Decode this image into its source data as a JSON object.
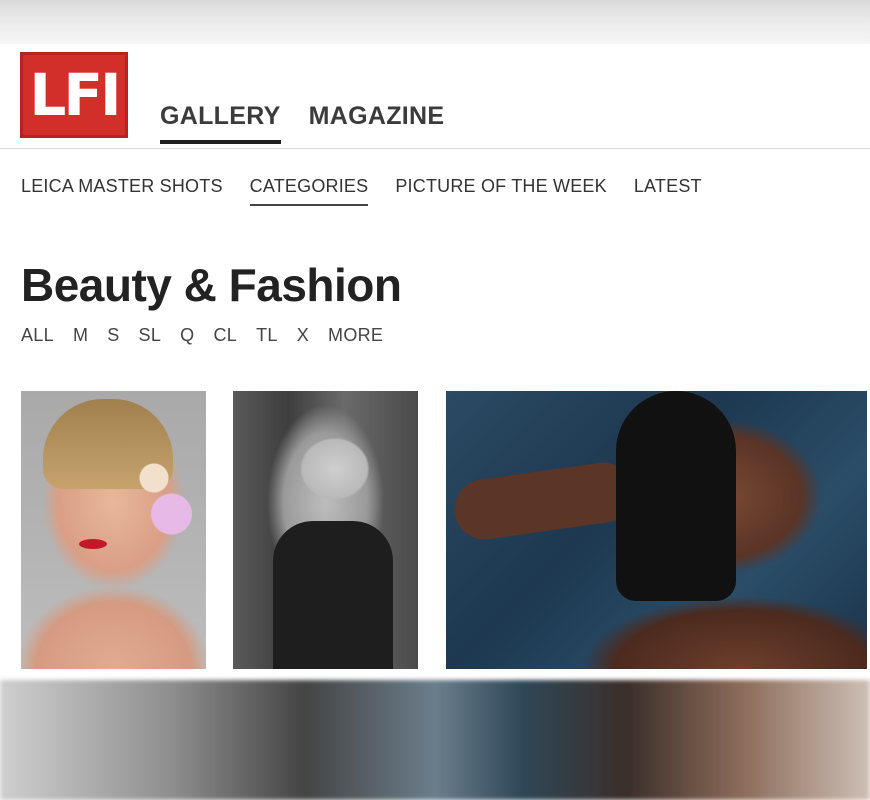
{
  "brand": {
    "logo_text": "LFI",
    "logo_color": "#d32f2a"
  },
  "main_nav": [
    {
      "label": "GALLERY",
      "active": true
    },
    {
      "label": "MAGAZINE",
      "active": false
    }
  ],
  "sub_nav": [
    {
      "label": "LEICA MASTER SHOTS",
      "active": false
    },
    {
      "label": "CATEGORIES",
      "active": true
    },
    {
      "label": "PICTURE OF THE WEEK",
      "active": false
    },
    {
      "label": "LATEST",
      "active": false
    }
  ],
  "page": {
    "title": "Beauty & Fashion"
  },
  "filters": [
    "ALL",
    "M",
    "S",
    "SL",
    "Q",
    "CL",
    "TL",
    "X",
    "MORE"
  ]
}
